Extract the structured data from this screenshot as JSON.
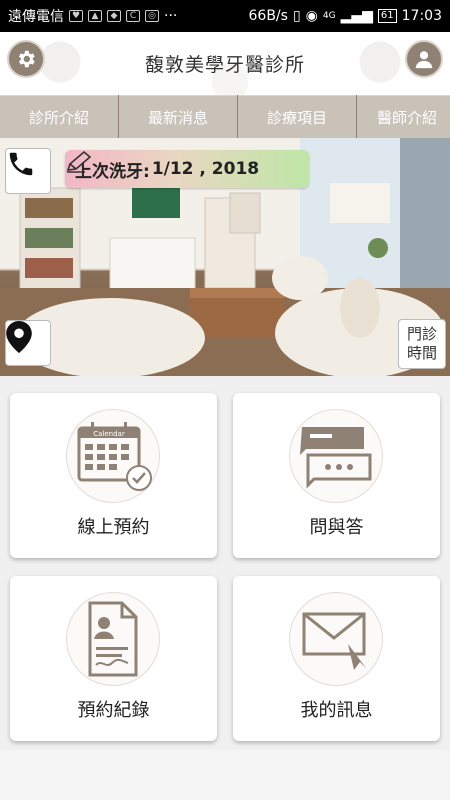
{
  "status_bar": {
    "carrier": "遠傳電信",
    "net_speed": "66B/s",
    "network": "4G",
    "battery": "61",
    "time": "17:03"
  },
  "header": {
    "title": "馥敦美學牙醫診所",
    "settings_icon": "gear-icon",
    "profile_icon": "user-icon"
  },
  "nav": {
    "items": [
      {
        "label": "診所介紹"
      },
      {
        "label": "最新消息"
      },
      {
        "label": "診療項目"
      },
      {
        "label": "醫師介紹"
      }
    ]
  },
  "hero": {
    "last_cleaning_label": "上次洗牙:",
    "last_cleaning_date": "1/12 , 2018",
    "clinic_hours_line1": "門診",
    "clinic_hours_line2": "時間",
    "icons": [
      "phone-icon",
      "location-pin-icon",
      "pencil-icon"
    ]
  },
  "cards": [
    {
      "label": "線上預約",
      "icon": "calendar-icon",
      "icon_text": "Calendar"
    },
    {
      "label": "問與答",
      "icon": "chat-icon"
    },
    {
      "label": "預約紀錄",
      "icon": "document-icon"
    },
    {
      "label": "我的訊息",
      "icon": "envelope-icon"
    }
  ],
  "colors": {
    "brand": "#8f8275",
    "nav_bg": "#c9c2b9",
    "card_bg": "#ffffff"
  }
}
